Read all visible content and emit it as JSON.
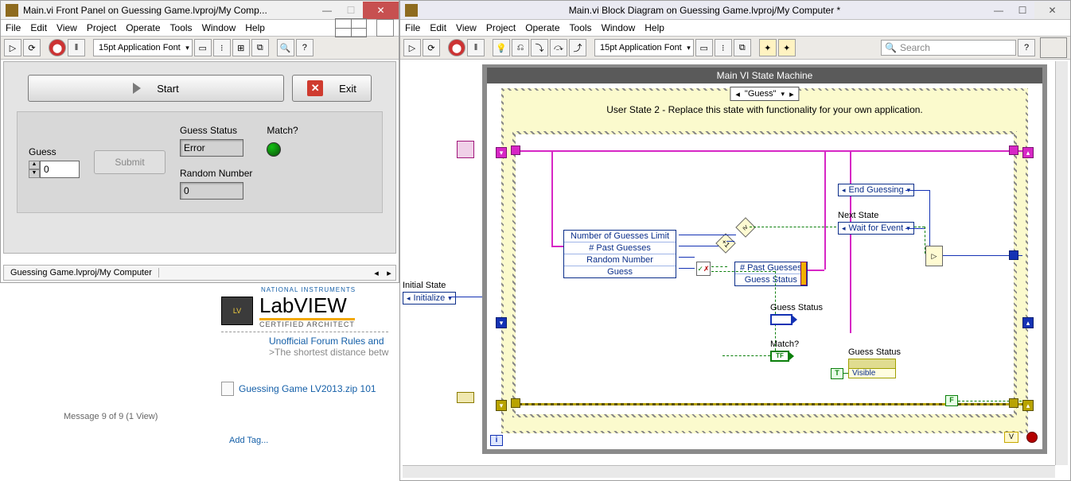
{
  "front_panel": {
    "title": "Main.vi Front Panel on Guessing Game.lvproj/My Comp...",
    "menus": [
      "File",
      "Edit",
      "View",
      "Project",
      "Operate",
      "Tools",
      "Window",
      "Help"
    ],
    "font": "15pt Application Font",
    "start_btn": "Start",
    "exit_btn": "Exit",
    "guess_label": "Guess",
    "guess_value": "0",
    "submit_btn": "Submit",
    "guess_status_label": "Guess Status",
    "guess_status_value": "Error",
    "match_label": "Match?",
    "random_number_label": "Random Number",
    "random_number_value": "0",
    "status_path": "Guessing Game.lvproj/My Computer"
  },
  "forum": {
    "ni_small": "NATIONAL INSTRUMENTS",
    "labview_text": "LabVIEW",
    "cert": "CERTIFIED ARCHITECT",
    "rules": "Unofficial Forum Rules and",
    "shortest": ">The shortest distance betw",
    "attachment": "Guessing Game LV2013.zip 101",
    "msg_counter": "Message 9 of 9 (1 View)",
    "add_tag": "Add Tag..."
  },
  "block_diagram": {
    "title": "Main.vi Block Diagram on Guessing Game.lvproj/My Computer *",
    "menus": [
      "File",
      "Edit",
      "View",
      "Project",
      "Operate",
      "Tools",
      "Window",
      "Help"
    ],
    "font": "15pt Application Font",
    "search_placeholder": "Search",
    "state_title": "Main VI State Machine",
    "case_value": "\"Guess\"",
    "case_hint": "User State 2 - Replace this state with functionality for your own application.",
    "initial_state_label": "Initial State",
    "initial_state_value": "Initialize",
    "unbundle": [
      "Number of Guesses Limit",
      "# Past Guesses",
      "Random Number",
      "Guess"
    ],
    "bundle": [
      "# Past Guesses",
      "Guess Status"
    ],
    "end_guessing": "End Guessing",
    "next_state_label": "Next State",
    "next_state_value": "Wait for Event",
    "guess_status_ind": "Guess Status",
    "match_ind": "Match?",
    "prop_node_label": "Guess Status",
    "prop_node_item": "Visible",
    "tf": "TF",
    "t": "T",
    "f": "F",
    "i": "i",
    "v": "V"
  }
}
